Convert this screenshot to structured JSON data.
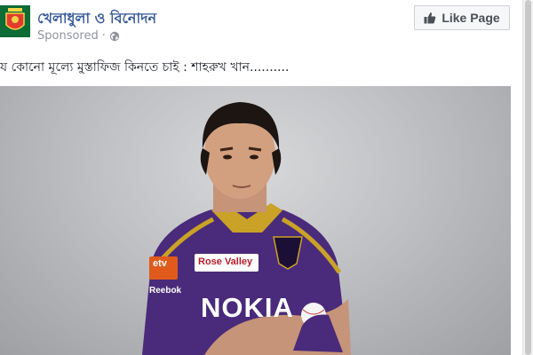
{
  "post": {
    "page_name": "খেলাধুলা ও বিনোদন",
    "sponsored_label": "Sponsored",
    "separator": "·",
    "like_button_label": "Like Page",
    "text": "য কোনো মূল্যে মুস্তাফিজ কিনতে চাই : শাহরুখ খান..........",
    "photo": {
      "jersey_text": "NOKIA",
      "sponsor_rose_valley": "Rose Valley",
      "sponsor_reebok": "Reebok",
      "sponsor_tv": "etv"
    }
  },
  "colors": {
    "link_blue": "#365899",
    "jersey_purple": "#4a2a7a",
    "jersey_gold": "#c9a227"
  }
}
